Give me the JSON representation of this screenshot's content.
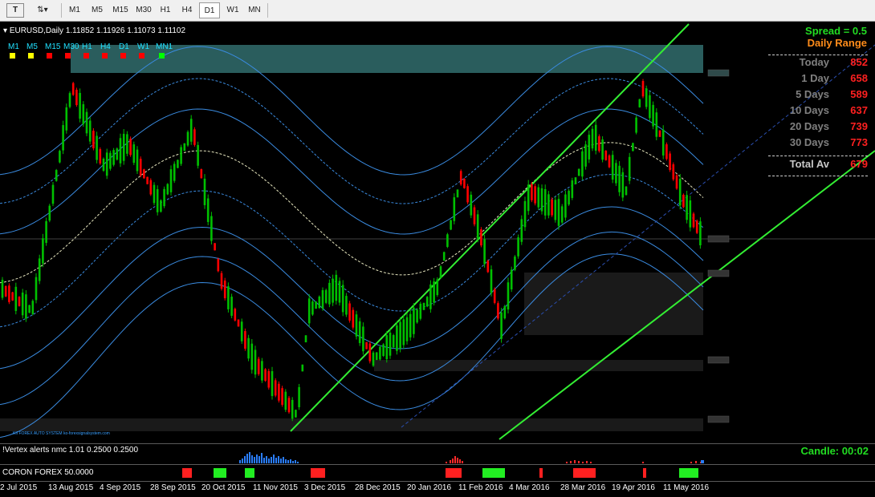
{
  "toolbar": {
    "tools": [
      {
        "name": "text-label-tool-icon",
        "glyph": "T"
      },
      {
        "name": "arrows-tool-icon",
        "glyph": "⇅▾"
      }
    ],
    "timeframes": [
      "M1",
      "M5",
      "M15",
      "M30",
      "H1",
      "H4",
      "D1",
      "W1",
      "MN"
    ],
    "active_timeframe": "D1"
  },
  "chart": {
    "symbol_line": "EURUSD,Daily  1.11852 1.11926 1.11073 1.11102",
    "mtf_signals": [
      {
        "label": "M1",
        "color": "#ffff00"
      },
      {
        "label": "M5",
        "color": "#ffff00"
      },
      {
        "label": "M15",
        "color": "#ff0000"
      },
      {
        "label": "M30",
        "color": "#ff0000"
      },
      {
        "label": "H1",
        "color": "#ff0000"
      },
      {
        "label": "H4",
        "color": "#ff0000"
      },
      {
        "label": "D1",
        "color": "#ff0000"
      },
      {
        "label": "W1",
        "color": "#ff0000"
      },
      {
        "label": "MN1",
        "color": "#00ff00"
      }
    ],
    "spread": "Spread = 0.5",
    "daily_range_title": "Daily Range",
    "daily_range": [
      {
        "label": "Today",
        "value": "852"
      },
      {
        "label": "1 Day",
        "value": "658"
      },
      {
        "label": "5 Days",
        "value": "589"
      },
      {
        "label": "10 Days",
        "value": "637"
      },
      {
        "label": "20 Days",
        "value": "739"
      },
      {
        "label": "30 Days",
        "value": "773"
      }
    ],
    "total": {
      "label": "Total Av",
      "value": "679"
    },
    "credit": "KII FOREX AUTO SYSTEM   ko-forexsignalsystem.com"
  },
  "indicator_vertex": {
    "label": "!Vertex alerts nmc 1.01 0.2500 0.2500",
    "candle_timer": "Candle:  00:02"
  },
  "indicator_coron": {
    "label": "CORON FOREX 50.0000"
  },
  "x_axis": {
    "dates": [
      "2 Jul 2015",
      "13 Aug 2015",
      "4 Sep 2015",
      "28 Sep 2015",
      "20 Oct 2015",
      "11 Nov 2015",
      "3 Dec 2015",
      "28 Dec 2015",
      "20 Jan 2016",
      "11 Feb 2016",
      "4 Mar 2016",
      "28 Mar 2016",
      "19 Apr 2016",
      "11 May 2016"
    ]
  },
  "colors": {
    "bull": "#00c000",
    "bear": "#ff0000",
    "band": "#3a8be0",
    "channel": "#33ee33",
    "zone": "#2a5d5d"
  }
}
